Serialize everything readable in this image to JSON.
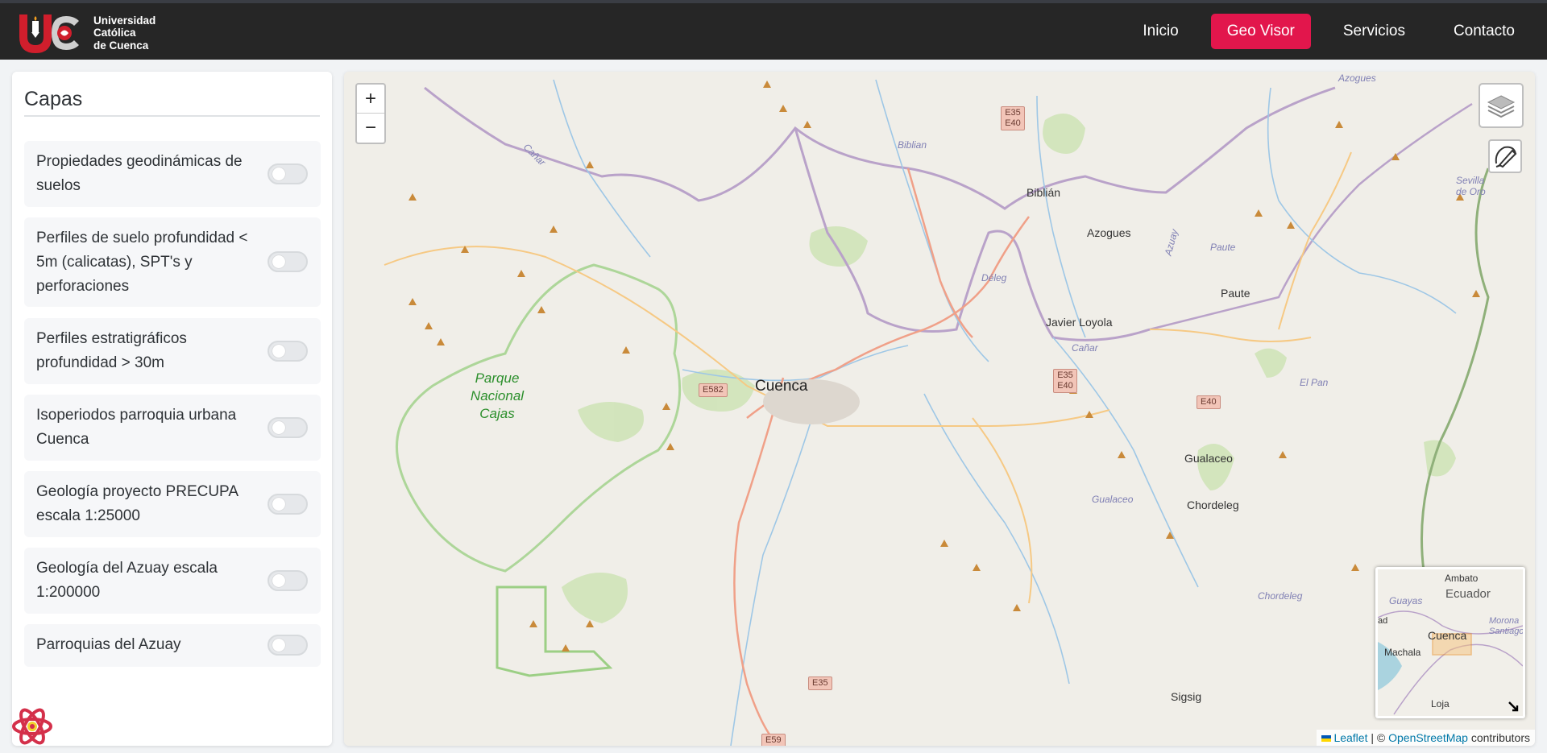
{
  "brand": {
    "line1": "Universidad",
    "line2": "Católica",
    "line3": "de Cuenca"
  },
  "nav": {
    "items": [
      {
        "label": "Inicio",
        "active": false
      },
      {
        "label": "Geo Visor",
        "active": true
      },
      {
        "label": "Servicios",
        "active": false
      },
      {
        "label": "Contacto",
        "active": false
      }
    ],
    "accent": "#e2164c"
  },
  "sidebar": {
    "title": "Capas",
    "layers": [
      {
        "label": "Propiedades geodinámicas de suelos",
        "enabled": false
      },
      {
        "label": "Perfiles de suelo profundidad < 5m (calicatas), SPT's y perforaciones",
        "enabled": false
      },
      {
        "label": "Perfiles estratigráficos profundidad > 30m",
        "enabled": false
      },
      {
        "label": "Isoperiodos parroquia urbana Cuenca",
        "enabled": false
      },
      {
        "label": "Geología proyecto PRECUPA escala 1:25000",
        "enabled": false
      },
      {
        "label": "Geología del Azuay escala 1:200000",
        "enabled": false
      },
      {
        "label": "Parroquias del Azuay",
        "enabled": false
      }
    ]
  },
  "map": {
    "zoom_in": "+",
    "zoom_out": "−",
    "places": {
      "cuenca": "Cuenca",
      "biblian": "Biblián",
      "azogues": "Azogues",
      "javier_loyola": "Javier Loyola",
      "paute": "Paute",
      "gualaceo": "Gualaceo",
      "chordeleg": "Chordeleg",
      "sigsig": "Sigsig",
      "park": "Parque Nacional Cajas"
    },
    "rivers": {
      "biblian": "Biblian",
      "azogues_top": "Azogues",
      "canar_top": "Cañar",
      "canar_mid": "Cañar",
      "deleg": "Déleg",
      "paute": "Paute",
      "azuay": "Azuay",
      "el_pan": "El Pan",
      "gualaceo": "Gualaceo",
      "chordeleg": "Chordeleg",
      "sevilla": "Sevilla de Oro"
    },
    "shields": {
      "e35_e40_top": "E35 E40",
      "e35_e40_mid": "E35 E40",
      "e582": "E582",
      "e40": "E40",
      "e35": "E35",
      "e59": "E59"
    },
    "minimap": {
      "ambato": "Ambato",
      "ecuador": "Ecuador",
      "guayas": "Guayas",
      "cuenca": "Cuenca",
      "machala": "Machala",
      "loja": "Loja",
      "morona": "Morona Santiago",
      "ad": "ad"
    },
    "attribution": {
      "leaflet": "Leaflet",
      "separator": "| ©",
      "osm": "OpenStreetMap",
      "suffix": "contributors"
    }
  }
}
